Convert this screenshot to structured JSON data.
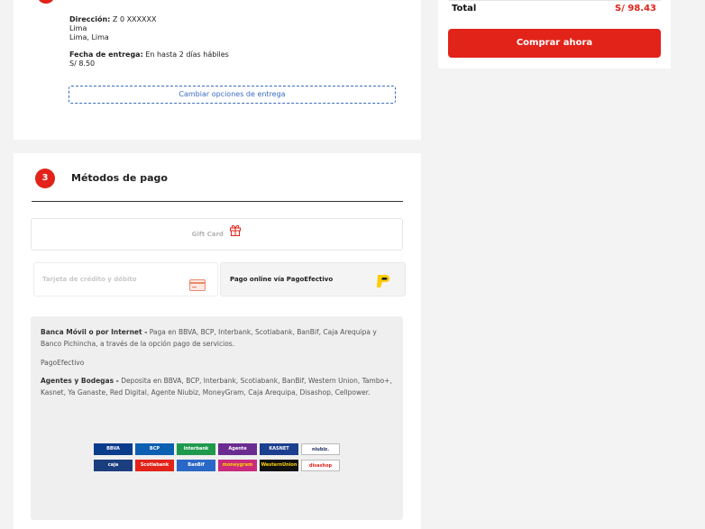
{
  "delivery": {
    "address_label": "Dirección:",
    "address_value": "Z 0 XXXXXX",
    "city": "Lima",
    "region": "Lima, Lima",
    "date_label": "Fecha de entrega:",
    "date_value": "En hasta 2 días hábiles",
    "price": "S/ 8.50",
    "change_button": "Cambiar opciones de entrega"
  },
  "payment": {
    "step_number": "3",
    "title": "Métodos de pago",
    "giftcard_label": "Gift Card",
    "credit_label": "Tarjeta de crédito y débito",
    "pagoefectivo_label": "Pago online vía PagoEfectivo",
    "info": {
      "banca_title": "Banca Móvil o por Internet -",
      "banca_text": "Paga en BBVA, BCP, Interbank, Scotiabank, BanBif, Caja Arequipa y Banco Pichincha, a través de la opción pago de servicios.",
      "pagoefectivo": "PagoEfectivo",
      "agentes_title": "Agentes y Bodegas -",
      "agentes_text": "Deposita en BBVA, BCP, Interbank, Scotiabank, BanBif, Western Union, Tambo+, Kasnet, Ya Ganaste, Red Digital, Agente Niubiz, MoneyGram, Caja Arequipa, Disashop, Cellpower."
    },
    "banks": [
      {
        "name": "BBVA",
        "bg": "#0b3c8c",
        "fg": "#ffffff"
      },
      {
        "name": "BCP",
        "bg": "#0c5fb1",
        "fg": "#ffffff"
      },
      {
        "name": "Interbank",
        "bg": "#1f9a4c",
        "fg": "#ffffff"
      },
      {
        "name": "Agente",
        "bg": "#6b2c91",
        "fg": "#ffffff"
      },
      {
        "name": "KASNET",
        "bg": "#1d3f8f",
        "fg": "#ffffff"
      },
      {
        "name": "niubiz.",
        "bg": "#ffffff",
        "fg": "#1e2b5c"
      },
      {
        "name": "caja",
        "bg": "#1b3e7e",
        "fg": "#ffffff"
      },
      {
        "name": "Scotiabank",
        "bg": "#e2231a",
        "fg": "#ffffff"
      },
      {
        "name": "BanBif",
        "bg": "#2a68c8",
        "fg": "#ffffff"
      },
      {
        "name": "moneygram",
        "bg": "#c92b7c",
        "fg": "#ffd400"
      },
      {
        "name": "WesternUnion",
        "bg": "#111111",
        "fg": "#ffd400"
      },
      {
        "name": "disashop",
        "bg": "#ffffff",
        "fg": "#e2231a"
      }
    ]
  },
  "summary": {
    "total_label": "Total",
    "total_value": "S/ 98.43",
    "buy_button": "Comprar ahora"
  },
  "colors": {
    "accent": "#e2231a",
    "link": "#3a6cc4",
    "pagoefectivo_yellow": "#ffcc00"
  }
}
